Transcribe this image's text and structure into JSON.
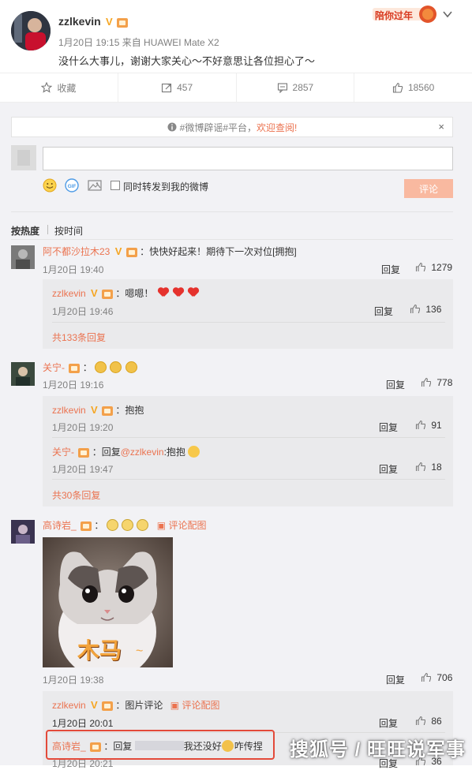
{
  "post": {
    "username": "zzlkevin",
    "verified_mark": "V",
    "meta": "1月20日 19:15 来自 HUAWEI Mate X2",
    "content": "没什么大事儿，谢谢大家关心～不好意思让各位担心了～",
    "badge": "陪你过年"
  },
  "toolbar": {
    "favorite": "收藏",
    "repost_count": "457",
    "comment_count": "2857",
    "like_count": "18560"
  },
  "notice": {
    "hashtag": "#微博辟谣#平台，",
    "link": "欢迎查阅!",
    "close": "×"
  },
  "composer": {
    "checkbox_label": "同时转发到我的微博",
    "submit": "评论"
  },
  "sort": {
    "by_hot": "按热度",
    "by_time": "按时间"
  },
  "comments": [
    {
      "user": "阿不都沙拉木23",
      "text": "：快快好起来！期待下一次对位[拥抱]",
      "time": "1月20日 19:40",
      "reply": "回复",
      "likes": "1279",
      "replies": [
        {
          "user": "zzlkevin",
          "text": "：嗯嗯！",
          "time": "1月20日 19:46",
          "reply": "回复",
          "likes": "136"
        }
      ],
      "more": "共133条回复"
    },
    {
      "user": "关宁-",
      "text": "：",
      "time": "1月20日 19:16",
      "reply": "回复",
      "likes": "778",
      "replies": [
        {
          "user": "zzlkevin",
          "text": "：抱抱",
          "time": "1月20日 19:20",
          "reply": "回复",
          "likes": "91"
        },
        {
          "user": "关宁-",
          "text": "：回复",
          "mention": "@zzlkevin",
          "tail": ":抱抱",
          "time": "1月20日 19:47",
          "reply": "回复",
          "likes": "18"
        }
      ],
      "more": "共30条回复"
    },
    {
      "user": "高诗岩_",
      "text": "：",
      "image_link": "评论配图",
      "image_caption": "木马",
      "time": "1月20日 19:38",
      "reply": "回复",
      "likes": "706",
      "replies": [
        {
          "user": "zzlkevin",
          "text": "：图片评论",
          "image_link": "评论配图",
          "time": "1月20日 20:01",
          "reply": "回复",
          "likes": "86"
        },
        {
          "user": "高诗岩_",
          "text": "：回复",
          "tail": "我还没好",
          "tail2": "咋传捏",
          "time": "1月20日 20:21",
          "reply": "回复",
          "likes": "36"
        }
      ]
    }
  ],
  "watermark": "搜狐号 / 旺旺说军事",
  "colors": {
    "accent": "#eb7350",
    "reply_bg": "#eaeaec",
    "highlight_border": "#e34a3a"
  }
}
